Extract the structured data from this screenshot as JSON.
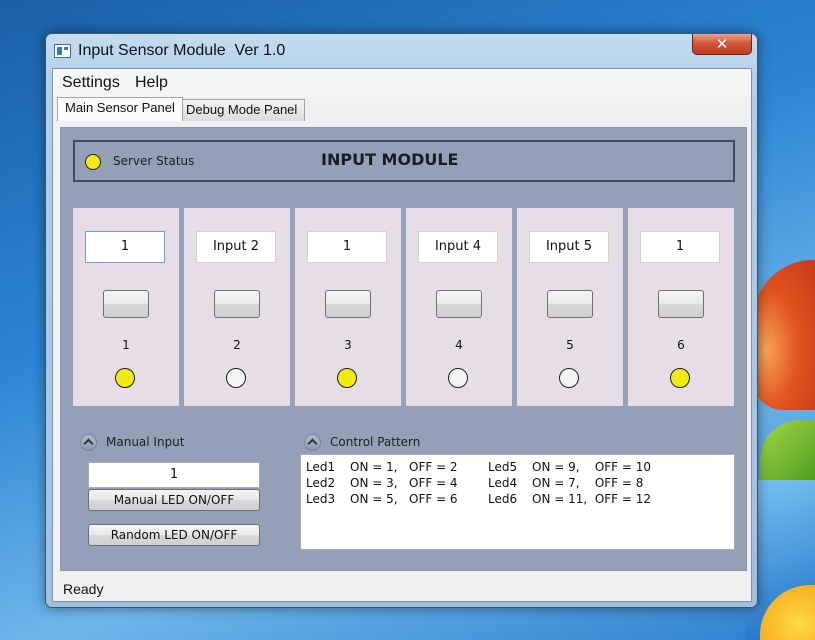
{
  "window": {
    "title": "Input Sensor Module  Ver 1.0",
    "close_label": "✕"
  },
  "menu": [
    {
      "label": "Settings"
    },
    {
      "label": "Help"
    }
  ],
  "tabs": [
    {
      "label": "Main Sensor Panel",
      "active": true
    },
    {
      "label": "Debug Mode Panel",
      "active": false
    }
  ],
  "header": {
    "server_status_label": "Server Status",
    "server_led_color": "#f2ea15",
    "title": "INPUT MODULE"
  },
  "sensors": [
    {
      "input_value": "1",
      "number": "1",
      "led_on": true
    },
    {
      "input_value": "Input 2",
      "number": "2",
      "led_on": false
    },
    {
      "input_value": "1",
      "number": "3",
      "led_on": true
    },
    {
      "input_value": "Input 4",
      "number": "4",
      "led_on": false
    },
    {
      "input_value": "Input 5",
      "number": "5",
      "led_on": false
    },
    {
      "input_value": "1",
      "number": "6",
      "led_on": true
    }
  ],
  "led_colors": {
    "on": "#f2ea15",
    "off": "#f4f4f4"
  },
  "manual_input": {
    "label": "Manual Input",
    "value": "1",
    "toggle_button": "Manual LED ON/OFF",
    "random_button": "Random LED ON/OFF"
  },
  "control_pattern": {
    "label": "Control Pattern",
    "rows": [
      {
        "led": "Led1",
        "text": "ON = 1,   OFF = 2"
      },
      {
        "led": "Led2",
        "text": "ON = 3,   OFF = 4"
      },
      {
        "led": "Led3",
        "text": "ON = 5,   OFF = 6"
      },
      {
        "led": "Led5",
        "text": "ON = 9,    OFF = 10"
      },
      {
        "led": "Led4",
        "text": "ON = 7,    OFF = 8"
      },
      {
        "led": "Led6",
        "text": "ON = 11,  OFF = 12"
      }
    ]
  },
  "status": {
    "text": "Ready"
  }
}
